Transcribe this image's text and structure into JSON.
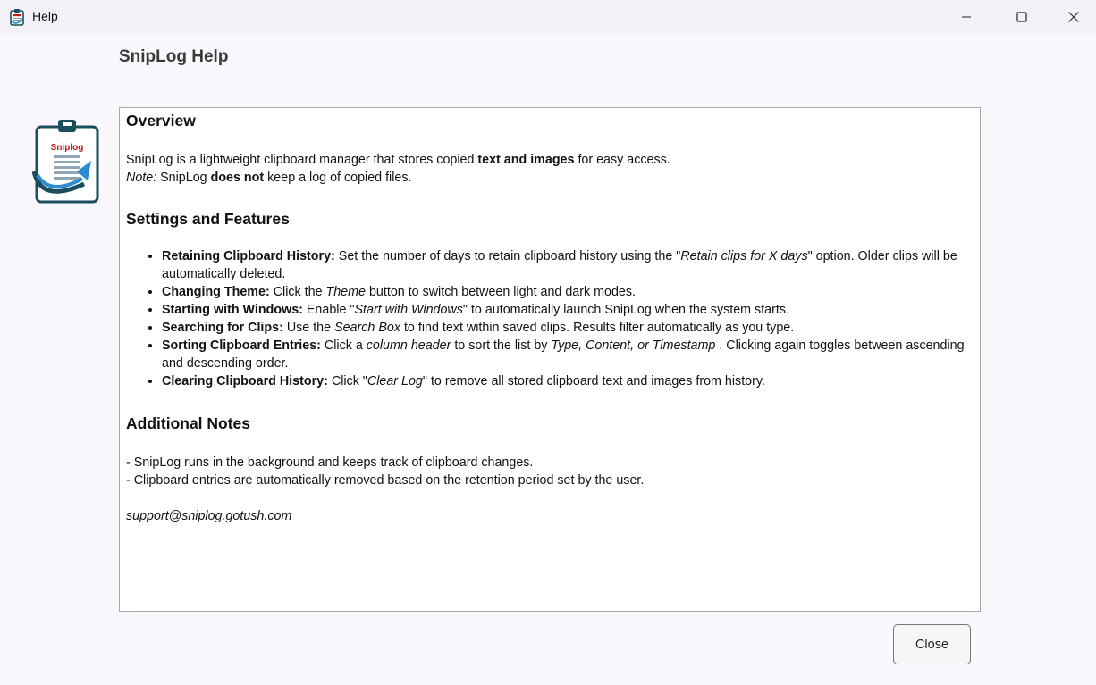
{
  "window": {
    "title": "Help",
    "icon": "clipboard-app-icon",
    "controls": [
      "minimize-icon",
      "maximize-icon",
      "close-icon"
    ]
  },
  "page": {
    "heading": "SnipLog Help",
    "logo_text": "Sniplog"
  },
  "overview": {
    "heading": "Overview",
    "intro_before": "SnipLog is a lightweight clipboard manager that stores copied ",
    "intro_bold": "text and images",
    "intro_after": " for easy access.",
    "note_label": "Note:",
    "note_before": " SnipLog ",
    "note_bold": "does not",
    "note_after": " keep a log of copied files."
  },
  "settings": {
    "heading": "Settings and Features",
    "items": [
      {
        "label": "Retaining Clipboard History:",
        "t1": " Set the number of days to retain clipboard history using the \"",
        "i1": "Retain clips for X days",
        "t2": "\" option. Older clips will be automatically deleted."
      },
      {
        "label": "Changing Theme:",
        "t1": " Click the ",
        "i1": "Theme",
        "t2": " button to switch between light and dark modes."
      },
      {
        "label": "Starting with Windows:",
        "t1": " Enable \"",
        "i1": "Start with Windows",
        "t2": "\" to automatically launch SnipLog when the system starts."
      },
      {
        "label": "Searching for Clips:",
        "t1": " Use the ",
        "i1": "Search Box",
        "t2": " to find text within saved clips. Results filter automatically as you type."
      },
      {
        "label": "Sorting Clipboard Entries:",
        "t1": " Click a ",
        "i1": "column header",
        "t2": " to sort the list by ",
        "i2": "Type, Content, or Timestamp",
        "t3": " . Clicking again toggles between ascending and descending order."
      },
      {
        "label": "Clearing Clipboard History:",
        "t1": " Click \"",
        "i1": "Clear Log",
        "t2": "\" to remove all stored clipboard text and images from history."
      }
    ]
  },
  "notes": {
    "heading": "Additional Notes",
    "lines": [
      "- SnipLog runs in the background and keeps track of clipboard changes.",
      "- Clipboard entries are automatically removed based on the retention period set by the user."
    ],
    "email": "support@sniplog.gotush.com"
  },
  "buttons": {
    "close_label": "Close"
  },
  "colors": {
    "titlebar": "#f3f1f5",
    "background": "#fbf8fd",
    "logo_teal": "#1b4e5c",
    "logo_red": "#c0141a",
    "logo_arrow": "#2b8ccf"
  }
}
